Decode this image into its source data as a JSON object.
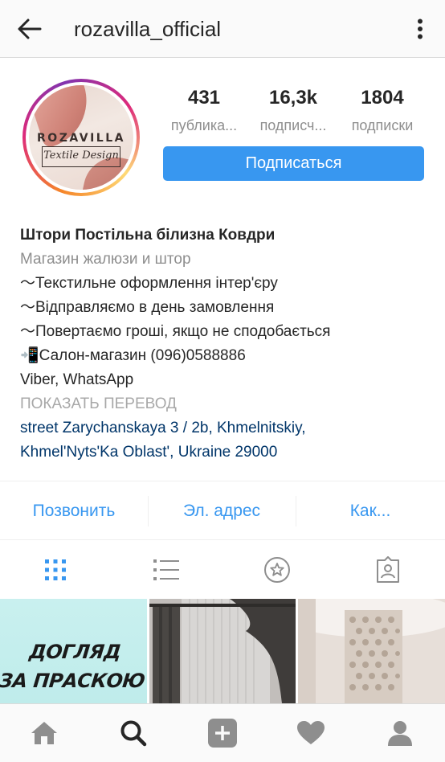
{
  "header": {
    "username": "rozavilla_official"
  },
  "profile": {
    "avatar_text": {
      "brand": "ROZAVILLA",
      "tagline": "Textile Design"
    },
    "stats": [
      {
        "value": "431",
        "label": "публика..."
      },
      {
        "value": "16,3k",
        "label": "подписч..."
      },
      {
        "value": "1804",
        "label": "подписки"
      }
    ],
    "follow_label": "Подписаться"
  },
  "bio": {
    "name": "Штори Постільна білизна Ковдри",
    "category": "Магазин жалюзи и штор",
    "lines": [
      "〜Текстильне оформлення інтер'єру",
      "〜Відправляємо в день замовлення",
      "〜Повертаємо гроші, якщо не сподобається",
      "📲Салон-магазин (096)0588886",
      "Viber, WhatsApp"
    ],
    "translate": "ПОКАЗАТЬ ПЕРЕВОД",
    "address_line1": "street Zarychanskaya 3 / 2b, Khmelnitskiy,",
    "address_line2": "Khmel'Nyts'Ka Oblast', Ukraine 29000"
  },
  "actions": {
    "call": "Позвонить",
    "email": "Эл. адрес",
    "directions": "Как..."
  },
  "tabs": [
    {
      "icon": "grid-icon",
      "active": true
    },
    {
      "icon": "list-icon",
      "active": false
    },
    {
      "icon": "star-icon",
      "active": false
    },
    {
      "icon": "tagged-icon",
      "active": false
    }
  ],
  "posts": {
    "first_caption_line1": "ДОГЛЯД",
    "first_caption_line2": "ЗА ПРАСКОЮ"
  },
  "bottom_nav": [
    "home-icon",
    "search-icon",
    "add-icon",
    "heart-icon",
    "profile-icon"
  ],
  "colors": {
    "accent": "#3897f0",
    "address": "#003569",
    "muted": "#8e8e8e"
  }
}
